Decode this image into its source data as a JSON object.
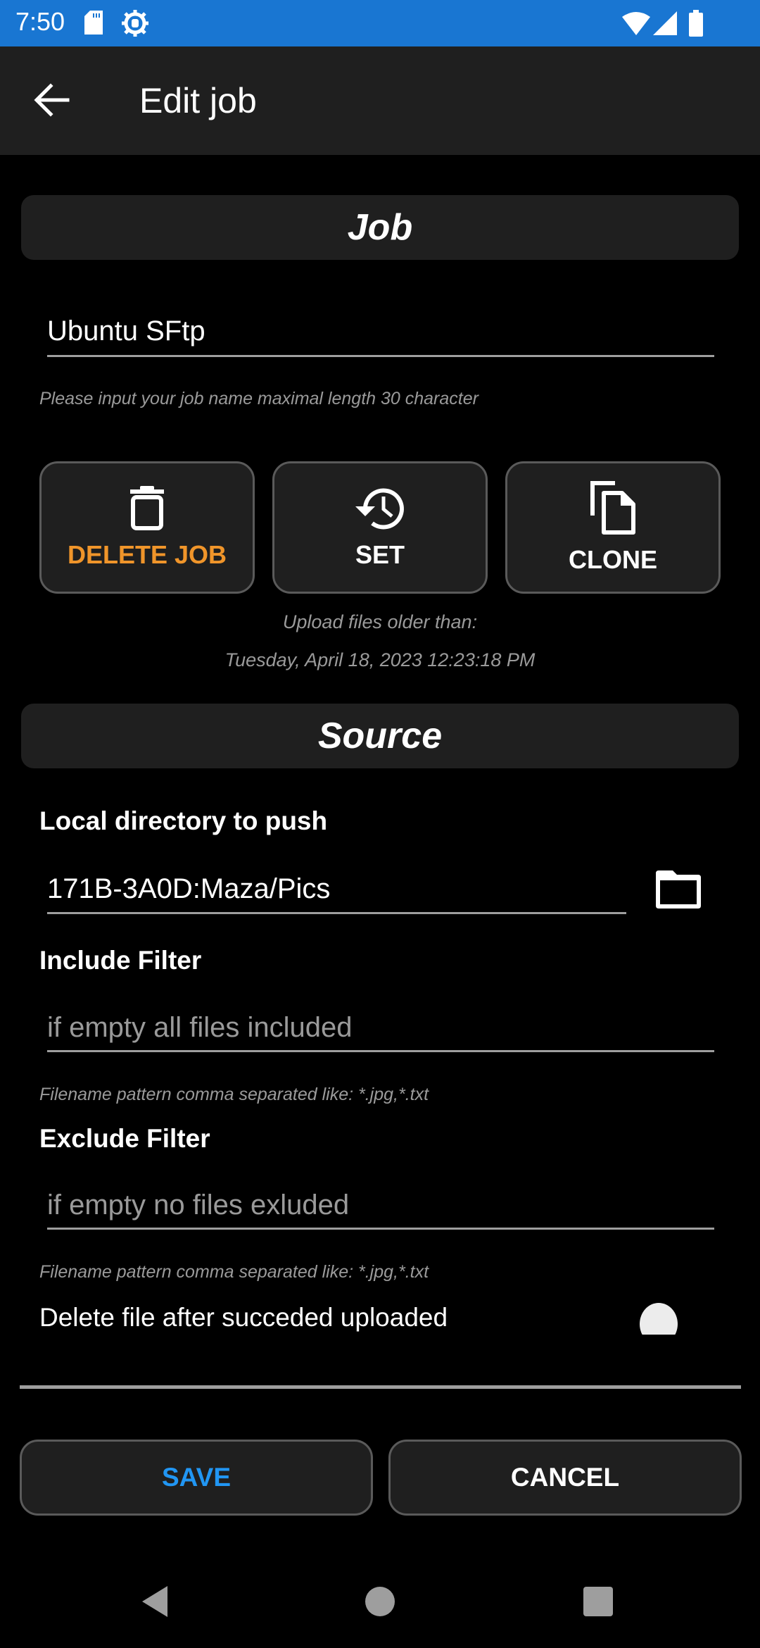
{
  "status_bar": {
    "time": "7:50",
    "left_icons": [
      "sd-card-icon",
      "debug-gear-icon"
    ],
    "right_icons": [
      "wifi-icon",
      "signal-icon",
      "battery-icon"
    ],
    "color": "#1976d2"
  },
  "app_bar": {
    "back_icon": "arrow-left-icon",
    "title": "Edit job"
  },
  "job_section": {
    "header": "Job",
    "job_name_value": "Ubuntu SFtp",
    "job_name_hint": "Please input your job name maximal length 30 character",
    "actions": [
      {
        "label": "DELETE JOB",
        "icon": "trash-icon",
        "color": "#f0952a"
      },
      {
        "label": "SET",
        "icon": "history-icon",
        "color": "#ffffff"
      },
      {
        "label": "CLONE",
        "icon": "copy-icon",
        "color": "#ffffff"
      }
    ],
    "upload_older_label": "Upload files older than:",
    "upload_older_date": "Tuesday, April 18, 2023 12:23:18 PM"
  },
  "source_section": {
    "header": "Source",
    "local_dir_label": "Local directory to push",
    "local_dir_value": "171B-3A0D:Maza/Pics",
    "folder_icon": "folder-icon",
    "include_label": "Include Filter",
    "include_placeholder": "if empty all files included",
    "include_hint": "Filename pattern comma separated like: *.jpg,*.txt",
    "exclude_label": "Exclude Filter",
    "exclude_placeholder": "if empty no files exluded",
    "exclude_hint": "Filename pattern comma separated like: *.jpg,*.txt",
    "delete_after_label": "Delete file after succeded uploaded",
    "delete_after_enabled": false
  },
  "footer": {
    "save_label": "SAVE",
    "save_color": "#2196f3",
    "cancel_label": "CANCEL"
  },
  "nav_bar": {
    "icons": [
      "nav-back-icon",
      "nav-home-icon",
      "nav-recents-icon"
    ]
  }
}
